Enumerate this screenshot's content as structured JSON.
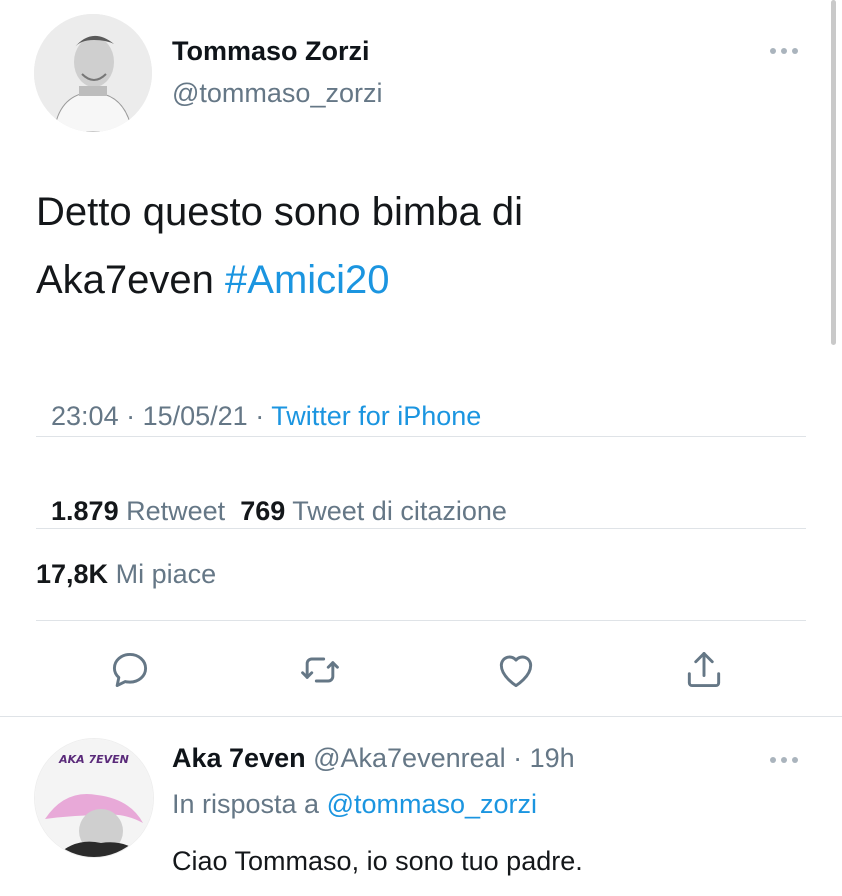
{
  "tweet": {
    "author_name": "Tommaso Zorzi",
    "author_handle": "@tommaso_zorzi",
    "text_line1": "Detto questo sono bimba di",
    "text_line2_plain": "Aka7even ",
    "hashtag": "#Amici20",
    "time": "23:04",
    "sep1": " · ",
    "date": "15/05/21",
    "sep2": " · ",
    "source": "Twitter for iPhone",
    "retweets_count": "1.879",
    "retweets_label": "Retweet",
    "quotes_count": "769",
    "quotes_label": "Tweet di citazione",
    "likes_count": "17,8K",
    "likes_label": "Mi piace"
  },
  "reply": {
    "author_name": "Aka 7even",
    "author_handle": "@Aka7evenreal",
    "sep": " · ",
    "time_ago": "19h",
    "in_reply_prefix": "In risposta a ",
    "in_reply_handle": "@tommaso_zorzi",
    "text": "Ciao Tommaso, io sono tuo padre.",
    "avatar_logo_text": "AKA 7EVEN"
  },
  "colors": {
    "accent": "#1b95e0",
    "muted": "#657786",
    "icon": "#657786",
    "divider": "#dfe3e7"
  },
  "icons": [
    "reply-icon",
    "retweet-icon",
    "like-icon",
    "share-icon",
    "more-icon"
  ]
}
